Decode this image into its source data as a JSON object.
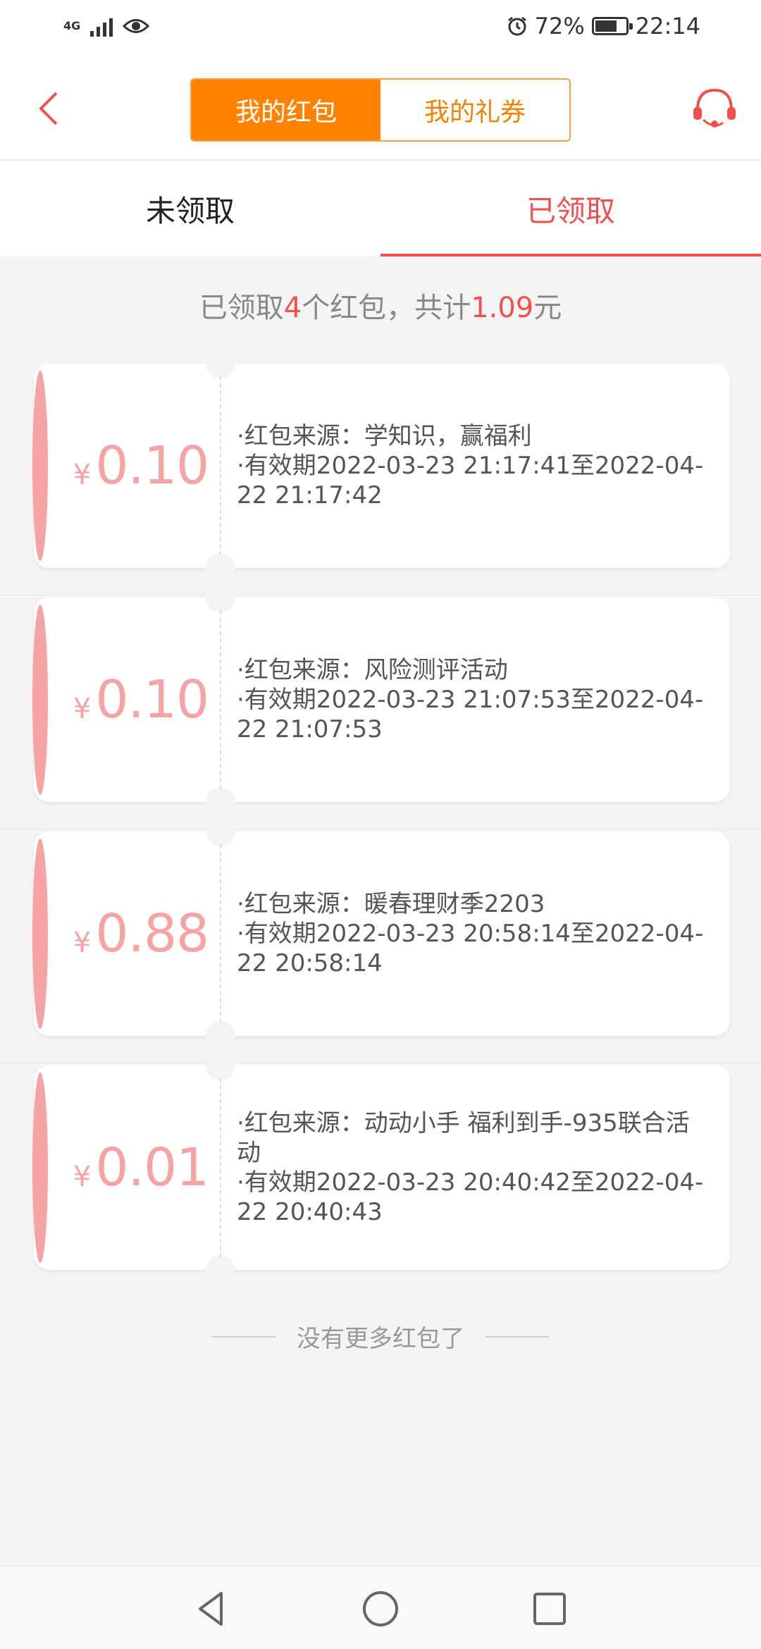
{
  "status_bar": {
    "network": "4G",
    "battery": "72%",
    "battery_level": 0.72,
    "time": "22:14"
  },
  "header": {
    "segments": [
      "我的红包",
      "我的礼券"
    ],
    "active_segment": 0
  },
  "tabs": [
    "未领取",
    "已领取"
  ],
  "active_tab": 1,
  "summary": {
    "prefix": "已领取",
    "count": "4",
    "middle": "个红包，共计",
    "total": "1.09",
    "suffix": "元"
  },
  "currency_symbol": "¥",
  "cards": [
    {
      "amount": "0.10",
      "source": "·红包来源：学知识，赢福利",
      "validity": "·有效期2022-03-23 21:17:41至2022-04-22 21:17:42"
    },
    {
      "amount": "0.10",
      "source": "·红包来源：风险测评活动",
      "validity": "·有效期2022-03-23 21:07:53至2022-04-22 21:07:53"
    },
    {
      "amount": "0.88",
      "source": "·红包来源：暖春理财季2203",
      "validity": "·有效期2022-03-23 20:58:14至2022-04-22 20:58:14"
    },
    {
      "amount": "0.01",
      "source": "·红包来源：动动小手 福利到手-935联合活动",
      "validity": "·有效期2022-03-23 20:40:42至2022-04-22 20:40:43"
    }
  ],
  "footer_text": "没有更多红包了",
  "colors": {
    "accent_orange": "#ff8200",
    "accent_red": "#f05050",
    "card_pink": "#f6a3a6"
  }
}
